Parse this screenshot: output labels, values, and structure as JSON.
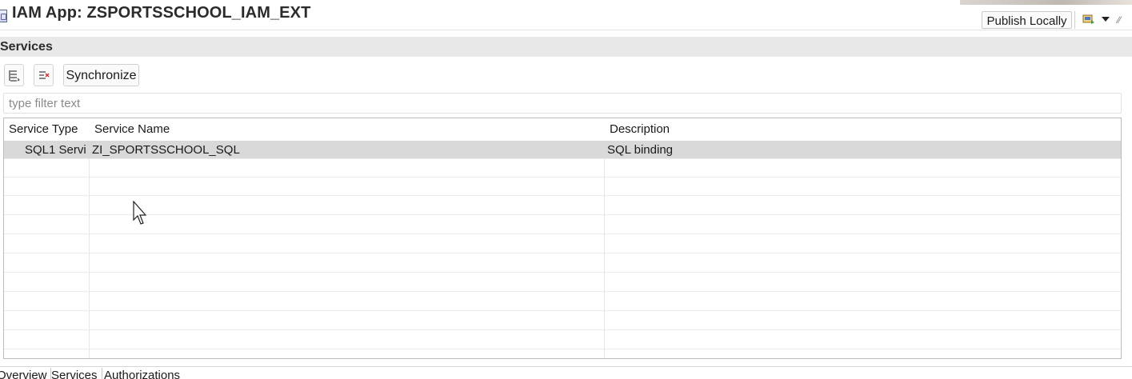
{
  "header": {
    "title": "IAM App: ZSPORTSSCHOOL_IAM_EXT",
    "publish_label": "Publish Locally",
    "icons": [
      "app-icon",
      "deploy-icon",
      "chevron-down-icon",
      "more-icon"
    ]
  },
  "section": {
    "title": "Services"
  },
  "toolbar": {
    "add_service_icon": "add-service-icon",
    "remove_service_icon": "remove-service-icon",
    "synchronize_label": "Synchronize"
  },
  "filter": {
    "placeholder": "type filter text",
    "value": ""
  },
  "table": {
    "columns": [
      "Service Type",
      "Service Name",
      "Description"
    ],
    "rows": [
      {
        "service_type": "SQL1 Servi",
        "service_name": "ZI_SPORTSSCHOOL_SQL",
        "description": "SQL binding"
      }
    ]
  },
  "bottom_tabs": [
    {
      "label": "Overview",
      "active": false
    },
    {
      "label": "Services",
      "active": true
    },
    {
      "label": "Authorizations",
      "active": false
    }
  ],
  "colors": {
    "selected_row": "#d9d9d9",
    "section_bar": "#e8e8e8"
  }
}
